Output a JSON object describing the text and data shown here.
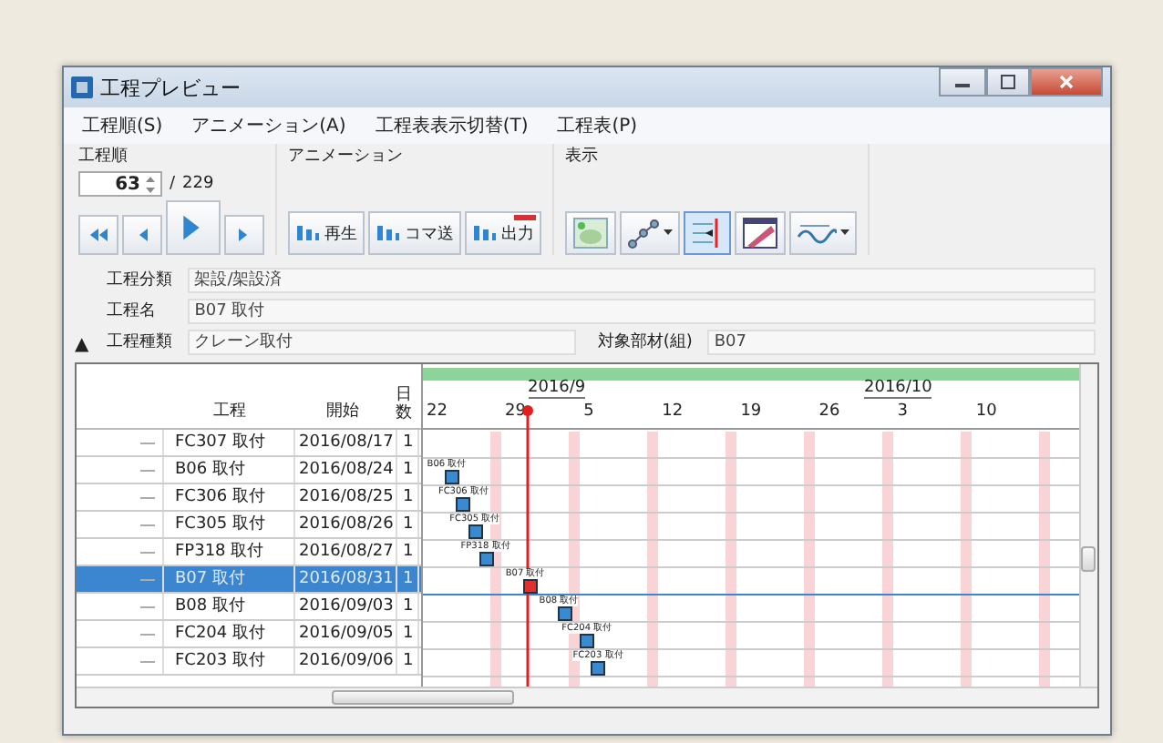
{
  "window": {
    "title": "工程プレビュー"
  },
  "menu": [
    "工程順(S)",
    "アニメーション(A)",
    "工程表表示切替(T)",
    "工程表(P)"
  ],
  "toolbar": {
    "order_label": "工程順",
    "order_value": "63",
    "order_sep": "/",
    "order_total": "229",
    "animation_label": "アニメーション",
    "display_label": "表示",
    "nav_buttons": [
      {
        "kind": "first"
      },
      {
        "kind": "prev"
      },
      {
        "kind": "play"
      },
      {
        "kind": "next"
      }
    ],
    "animation_buttons": [
      {
        "label": "再生",
        "badge": false
      },
      {
        "label": "コマ送",
        "badge": false
      },
      {
        "label": "出力",
        "badge": true
      }
    ],
    "display_tools": [
      {
        "kind": "map",
        "dropdown": false,
        "selected": false
      },
      {
        "kind": "nodes",
        "dropdown": true,
        "selected": false
      },
      {
        "kind": "lines",
        "dropdown": false,
        "selected": true
      },
      {
        "kind": "layers",
        "dropdown": false,
        "selected": false
      },
      {
        "kind": "wave",
        "dropdown": true,
        "selected": false
      }
    ]
  },
  "info": {
    "toggle": "▲",
    "fields": [
      {
        "label": "工程分類",
        "value": "架設/架設済"
      },
      {
        "label": "工程名",
        "value": "B07 取付"
      },
      {
        "label": "工程種類",
        "value": "クレーン取付",
        "extra_label": "対象部材(組)",
        "extra_value": "B07"
      }
    ]
  },
  "table": {
    "columns": [
      "工程",
      "開始",
      "日数"
    ],
    "months": [
      "2016/9",
      "2016/10"
    ],
    "days": [
      "22",
      "29",
      "5",
      "12",
      "19",
      "26",
      "3",
      "10"
    ],
    "rows": [
      {
        "name": "FC307 取付",
        "start": "2016/08/17",
        "days": "1",
        "selected": false
      },
      {
        "name": "B06 取付",
        "start": "2016/08/24",
        "days": "1",
        "selected": false,
        "bar_label": "B06 取付"
      },
      {
        "name": "FC306 取付",
        "start": "2016/08/25",
        "days": "1",
        "selected": false,
        "bar_label": "FC306 取付"
      },
      {
        "name": "FC305 取付",
        "start": "2016/08/26",
        "days": "1",
        "selected": false,
        "bar_label": "FC305 取付"
      },
      {
        "name": "FP318 取付",
        "start": "2016/08/27",
        "days": "1",
        "selected": false,
        "bar_label": "FP318 取付"
      },
      {
        "name": "B07 取付",
        "start": "2016/08/31",
        "days": "1",
        "selected": true,
        "bar_label": "B07 取付"
      },
      {
        "name": "B08 取付",
        "start": "2016/09/03",
        "days": "1",
        "selected": false,
        "bar_label": "B08 取付"
      },
      {
        "name": "FC204 取付",
        "start": "2016/09/05",
        "days": "1",
        "selected": false,
        "bar_label": "FC204 取付"
      },
      {
        "name": "FC203 取付",
        "start": "2016/09/06",
        "days": "1",
        "selected": false,
        "bar_label": "FC203 取付"
      }
    ]
  }
}
